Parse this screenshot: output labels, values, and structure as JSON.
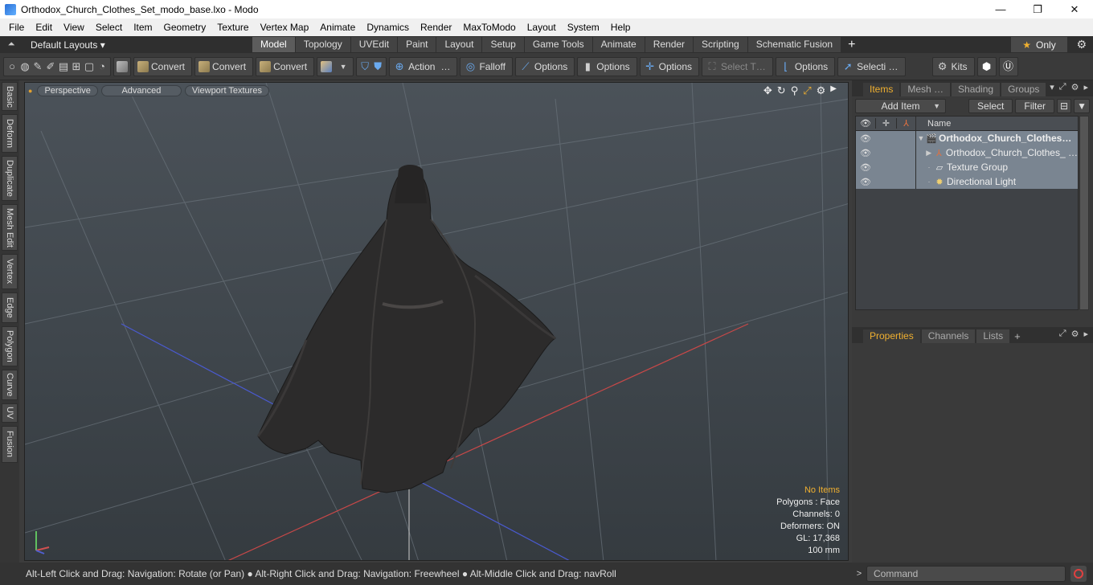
{
  "window": {
    "title": "Orthodox_Church_Clothes_Set_modo_base.lxo - Modo",
    "minimize": "—",
    "maximize": "❐",
    "close": "✕"
  },
  "menu": [
    "File",
    "Edit",
    "View",
    "Select",
    "Item",
    "Geometry",
    "Texture",
    "Vertex Map",
    "Animate",
    "Dynamics",
    "Render",
    "MaxToModo",
    "Layout",
    "System",
    "Help"
  ],
  "layoutbar": {
    "default_layouts": "Default Layouts ▾",
    "tabs": [
      "Model",
      "Topology",
      "UVEdit",
      "Paint",
      "Layout",
      "Setup",
      "Game Tools",
      "Animate",
      "Render",
      "Scripting",
      "Schematic Fusion"
    ],
    "active_tab": "Model",
    "only_label": "Only"
  },
  "toolbar": {
    "convert1": "Convert",
    "convert2": "Convert",
    "convert3": "Convert",
    "action": "Action",
    "action_more": "…",
    "falloff": "Falloff",
    "options1": "Options",
    "options2": "Options",
    "options3": "Options",
    "options4": "Options",
    "select_t": "Select T…",
    "selecti": "Selecti …",
    "kits": "Kits"
  },
  "left_tabs": [
    "Basic",
    "Deform",
    "Duplicate",
    "Mesh Edit",
    "Vertex",
    "Edge",
    "Polygon",
    "Curve",
    "UV",
    "Fusion"
  ],
  "viewport": {
    "perspective": "Perspective",
    "advanced": "Advanced",
    "viewport_textures": "Viewport Textures",
    "info": {
      "no_items": "No Items",
      "polygons": "Polygons : Face",
      "channels": "Channels: 0",
      "deformers": "Deformers: ON",
      "gl": "GL: 17,368",
      "scale": "100 mm"
    }
  },
  "status": "Alt-Left Click and Drag: Navigation: Rotate (or Pan) ● Alt-Right Click and Drag: Navigation: Freewheel ● Alt-Middle Click and Drag: navRoll",
  "items_panel": {
    "tabs": [
      "Items",
      "Mesh …",
      "Shading",
      "Groups"
    ],
    "active_tab": "Items",
    "add_item": "Add Item",
    "select": "Select",
    "filter": "Filter",
    "col_name": "Name",
    "rows": [
      {
        "name": "Orthodox_Church_Clothes…",
        "icon": "scene-icon"
      },
      {
        "name": "Orthodox_Church_Clothes_ …",
        "icon": "mesh-locator-icon"
      },
      {
        "name": "Texture Group",
        "icon": "texture-group-icon"
      },
      {
        "name": "Directional Light",
        "icon": "light-icon"
      }
    ]
  },
  "properties_panel": {
    "tabs": [
      "Properties",
      "Channels",
      "Lists"
    ],
    "active_tab": "Properties"
  },
  "command": {
    "placeholder": "Command"
  }
}
